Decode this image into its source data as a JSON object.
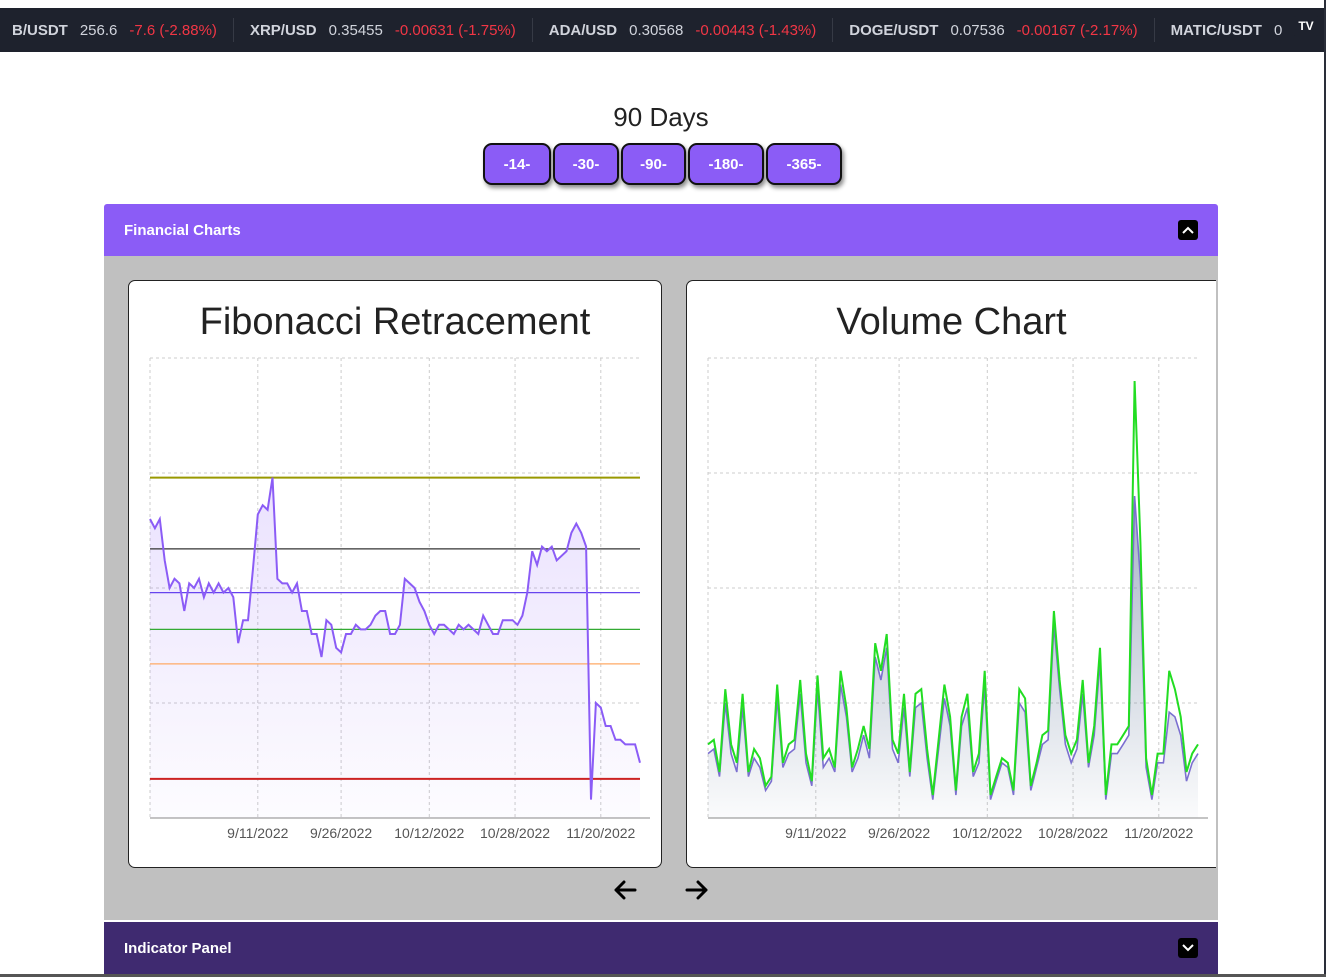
{
  "ticker": [
    {
      "symbol": "B/USDT",
      "price": "256.6",
      "change": "-7.6 (-2.88%)"
    },
    {
      "symbol": "XRP/USD",
      "price": "0.35455",
      "change": "-0.00631 (-1.75%)"
    },
    {
      "symbol": "ADA/USD",
      "price": "0.30568",
      "change": "-0.00443 (-1.43%)"
    },
    {
      "symbol": "DOGE/USDT",
      "price": "0.07536",
      "change": "-0.00167 (-2.17%)"
    },
    {
      "symbol": "MATIC/USDT",
      "price": "0",
      "change": ""
    }
  ],
  "ticker_logo": "TV",
  "period": {
    "title": "90 Days",
    "buttons": [
      "-14-",
      "-30-",
      "-90-",
      "-180-",
      "-365-"
    ]
  },
  "accordion": {
    "financial_label": "Financial Charts",
    "indicator_label": "Indicator Panel"
  },
  "colors": {
    "accent": "#8b5cf6",
    "indicator_header": "#3f2a70",
    "panel_bg": "#c0c0c0",
    "price_line": "#8b5cf6",
    "volume_line": "#22dd22",
    "fib_levels": [
      "#999900",
      "#333333",
      "#6644ee",
      "#33aa33",
      "#ffaa66",
      "#cc2222"
    ]
  },
  "chart_data": [
    {
      "type": "line",
      "title": "Fibonacci Retracement",
      "x_ticks": [
        "9/11/2022",
        "9/26/2022",
        "10/12/2022",
        "10/28/2022",
        "11/20/2022"
      ],
      "ylim": [
        0,
        100
      ],
      "grid": true,
      "fib_levels": [
        74,
        58.5,
        49,
        41,
        33.5,
        8.5
      ],
      "values": [
        65,
        63,
        65,
        56,
        50,
        52,
        51,
        45,
        51,
        50,
        52,
        48,
        51,
        49,
        51,
        49,
        50,
        48,
        38,
        43,
        43,
        54,
        66,
        68,
        67,
        74,
        52,
        51,
        51,
        49,
        51,
        45,
        45,
        40,
        40,
        35,
        43,
        42,
        37,
        36,
        40,
        40,
        42,
        41,
        41,
        42,
        44,
        45,
        45,
        40,
        40,
        42,
        52,
        51,
        50,
        47,
        45,
        42,
        40,
        42,
        42,
        41,
        40,
        42,
        41,
        42,
        41,
        40,
        44,
        42,
        40,
        40,
        43,
        43,
        43,
        42,
        44,
        49,
        58,
        55,
        59,
        58,
        59,
        56,
        57,
        58,
        62,
        64,
        62,
        59,
        4,
        25,
        24,
        20,
        20,
        17,
        17,
        16,
        16,
        16,
        12
      ]
    },
    {
      "type": "area",
      "title": "Volume Chart",
      "x_ticks": [
        "9/11/2022",
        "9/26/2022",
        "10/12/2022",
        "10/28/2022",
        "11/20/2022"
      ],
      "ylim": [
        0,
        100
      ],
      "grid": true,
      "series": [
        {
          "values": [
            16,
            17,
            10,
            28,
            16,
            12,
            27,
            10,
            15,
            13,
            7,
            9,
            29,
            12,
            16,
            17,
            30,
            14,
            8,
            31,
            13,
            15,
            11,
            32,
            24,
            11,
            15,
            20,
            15,
            38,
            32,
            40,
            17,
            14,
            27,
            10,
            27,
            28,
            15,
            5,
            17,
            29,
            22,
            6,
            22,
            27,
            10,
            14,
            32,
            5,
            9,
            13,
            12,
            6,
            28,
            26,
            7,
            12,
            18,
            19,
            45,
            30,
            18,
            14,
            17,
            30,
            12,
            20,
            37,
            5,
            16,
            16,
            18,
            20,
            95,
            60,
            13,
            5,
            14,
            14,
            32,
            28,
            22,
            10,
            14,
            16
          ]
        },
        {
          "values": [
            14,
            15,
            9,
            25,
            14,
            10,
            24,
            9,
            13,
            11,
            6,
            8,
            26,
            11,
            14,
            15,
            27,
            12,
            7,
            28,
            11,
            13,
            10,
            29,
            22,
            10,
            13,
            18,
            13,
            35,
            30,
            37,
            15,
            12,
            24,
            9,
            24,
            25,
            13,
            4,
            15,
            26,
            20,
            5,
            20,
            24,
            9,
            12,
            29,
            4,
            8,
            12,
            11,
            5,
            25,
            23,
            6,
            11,
            16,
            17,
            42,
            28,
            16,
            12,
            15,
            27,
            11,
            18,
            34,
            4,
            14,
            14,
            16,
            18,
            70,
            52,
            11,
            4,
            12,
            12,
            23,
            22,
            18,
            8,
            12,
            14
          ]
        }
      ]
    }
  ]
}
